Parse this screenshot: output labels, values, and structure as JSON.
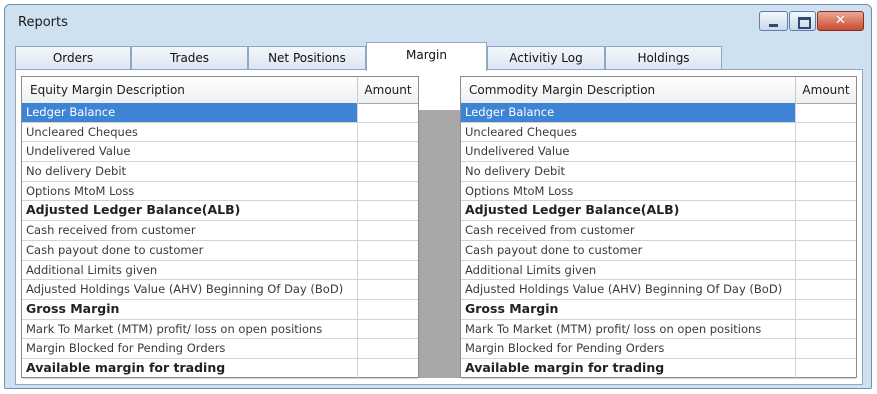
{
  "window": {
    "title": "Reports",
    "min_glyph": "",
    "max_glyph": "",
    "close_glyph": "✕"
  },
  "tabs": [
    {
      "label": "Orders"
    },
    {
      "label": "Trades"
    },
    {
      "label": "Net Positions"
    },
    {
      "label": "Margin",
      "active": true
    },
    {
      "label": "Activitiy Log"
    },
    {
      "label": "Holdings"
    }
  ],
  "equity": {
    "header_desc": "Equity Margin Description",
    "header_amount": "Amount",
    "rows": [
      {
        "label": "Ledger Balance",
        "amount": ""
      },
      {
        "label": "Uncleared Cheques",
        "amount": ""
      },
      {
        "label": "Undelivered Value",
        "amount": ""
      },
      {
        "label": "No delivery Debit",
        "amount": ""
      },
      {
        "label": "Options MtoM Loss",
        "amount": ""
      },
      {
        "label": "Adjusted Ledger Balance(ALB)",
        "amount": ""
      },
      {
        "label": "Cash received from customer",
        "amount": ""
      },
      {
        "label": "Cash payout done to customer",
        "amount": ""
      },
      {
        "label": "Additional Limits given",
        "amount": ""
      },
      {
        "label": "Adjusted Holdings Value (AHV) Beginning Of Day (BoD)",
        "amount": ""
      },
      {
        "label": "Gross Margin",
        "amount": ""
      },
      {
        "label": "Mark To Market (MTM) profit/ loss on open positions",
        "amount": ""
      },
      {
        "label": "Margin Blocked for Pending Orders",
        "amount": ""
      },
      {
        "label": "Available margin for trading",
        "amount": ""
      }
    ]
  },
  "commodity": {
    "header_desc": "Commodity Margin Description",
    "header_amount": "Amount",
    "rows": [
      {
        "label": "Ledger Balance",
        "amount": ""
      },
      {
        "label": "Uncleared Cheques",
        "amount": ""
      },
      {
        "label": "Undelivered Value",
        "amount": ""
      },
      {
        "label": "No delivery Debit",
        "amount": ""
      },
      {
        "label": "Options MtoM Loss",
        "amount": ""
      },
      {
        "label": "Adjusted Ledger Balance(ALB)",
        "amount": ""
      },
      {
        "label": "Cash received from customer",
        "amount": ""
      },
      {
        "label": "Cash payout done to customer",
        "amount": ""
      },
      {
        "label": "Additional Limits given",
        "amount": ""
      },
      {
        "label": "Adjusted Holdings Value (AHV) Beginning Of Day (BoD)",
        "amount": ""
      },
      {
        "label": "Gross Margin",
        "amount": ""
      },
      {
        "label": "Mark To Market (MTM) profit/ loss on open positions",
        "amount": ""
      },
      {
        "label": "Margin Blocked for Pending Orders",
        "amount": ""
      },
      {
        "label": "Available margin for trading",
        "amount": ""
      }
    ]
  },
  "colors": {
    "selection": "#3e84d4",
    "window_frame": "#cfe0f1",
    "divider": "#a8a8a8"
  }
}
